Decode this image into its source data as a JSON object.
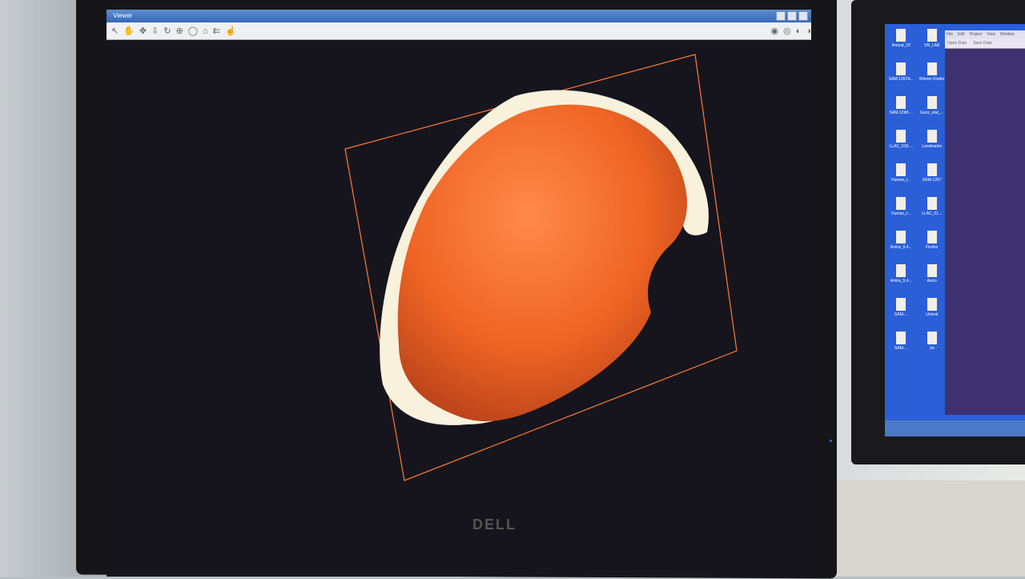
{
  "viewer": {
    "title": "Viewer",
    "toolbar_left": [
      "pointer-icon",
      "hand-icon",
      "move-icon",
      "pan-down-icon",
      "rotate-icon",
      "zoom-icon",
      "lasso-icon",
      "home-icon",
      "seek-icon",
      "pick-icon"
    ],
    "toolbar_right": [
      "view-front-icon",
      "view-back-icon",
      "view-side-icon",
      "view-top-icon"
    ],
    "bounding_box_color": "#ff7a3a",
    "surface_color": "#f06a2a",
    "bone_color": "#f8f1dc",
    "background_color": "#16151d"
  },
  "monitor": {
    "brand": "DELL"
  },
  "second_screen": {
    "desktop_icons": [
      "Ilmoud_10",
      "VR_LAB",
      "SAM-1267A...",
      "Wiener Kinder",
      "SAM-1268-...",
      "Gunz_etal_...",
      "LLAC_018-...",
      "Landmarks",
      "Human_t...",
      "SAM-1267",
      "Human_t...",
      "LLAC_01...",
      "Amira_5.4...",
      "Firefox",
      "Amira_5.4...",
      "Avizo",
      "SAM-...",
      "Unreal",
      "SAM-...",
      "Jw"
    ],
    "app_menu": [
      "File",
      "Edit",
      "Project",
      "View",
      "Window"
    ],
    "app_toolbar": [
      "Open Data",
      "Save Data"
    ]
  }
}
